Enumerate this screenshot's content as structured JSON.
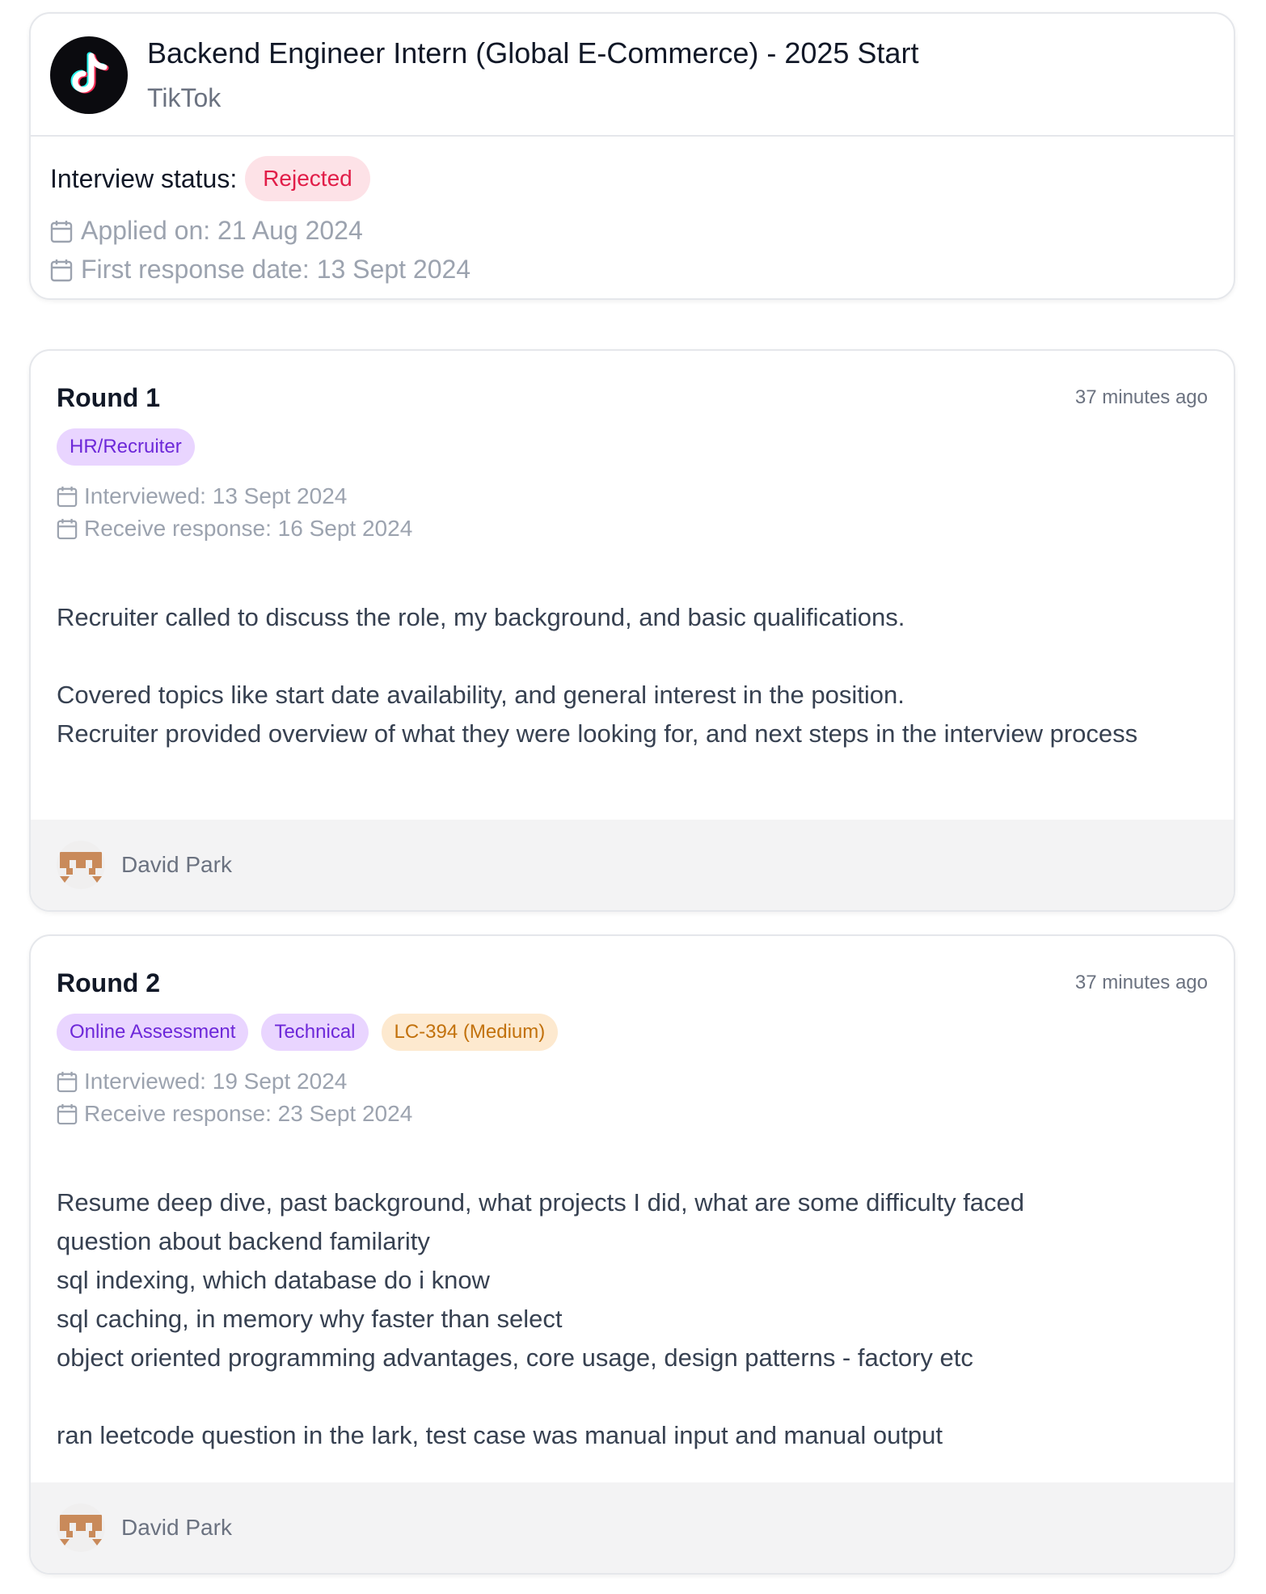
{
  "job": {
    "title": "Backend Engineer Intern (Global E-Commerce) - 2025 Start",
    "company": "TikTok",
    "logo_icon": "tiktok-logo",
    "status_label": "Interview status:",
    "status": "Rejected",
    "applied_on": "Applied on: 21 Aug 2024",
    "first_response": "First response date: 13 Sept 2024"
  },
  "rounds": [
    {
      "title": "Round 1",
      "time_ago": "37 minutes ago",
      "tags": [
        {
          "label": "HR/Recruiter",
          "color": "purple"
        }
      ],
      "interviewed": "Interviewed: 13 Sept 2024",
      "received": "Receive response: 16 Sept 2024",
      "notes": [
        "Recruiter called to discuss the role, my background, and basic qualifications.",
        "",
        "Covered topics like start date availability, and general interest in the position.",
        "Recruiter provided overview of what they were looking for, and next steps in the interview process"
      ],
      "author": "David Park"
    },
    {
      "title": "Round 2",
      "time_ago": "37 minutes ago",
      "tags": [
        {
          "label": "Online Assessment",
          "color": "purple"
        },
        {
          "label": "Technical",
          "color": "purple"
        },
        {
          "label": "LC-394 (Medium)",
          "color": "orange"
        }
      ],
      "interviewed": "Interviewed: 19 Sept 2024",
      "received": "Receive response: 23 Sept 2024",
      "notes": [
        "Resume deep dive, past background, what projects I did, what are some difficulty faced",
        "question about backend familarity",
        "sql indexing, which database do i know",
        "sql caching, in memory why faster than select",
        "object oriented programming advantages, core usage, design patterns - factory etc",
        "",
        "ran leetcode question in the lark, test case was manual input and manual output"
      ],
      "author": "David Park"
    }
  ],
  "colors": {
    "rejected_text": "#e11d48",
    "rejected_bg": "#fde2e7",
    "tag_purple_bg": "#e9d5ff",
    "tag_purple_text": "#6d28d9",
    "tag_orange_bg": "#fde9cf",
    "tag_orange_text": "#c2710c",
    "avatar_color": "#c98a5a"
  }
}
